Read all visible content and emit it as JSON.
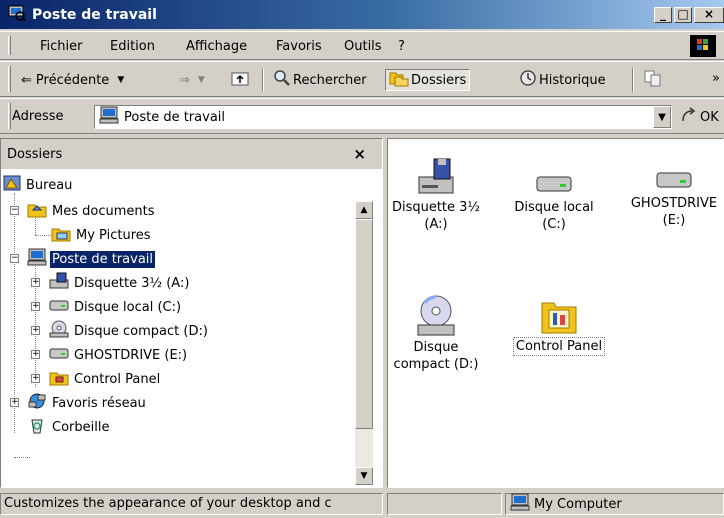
{
  "window": {
    "title": "Poste de travail",
    "buttons": {
      "minimize": "_",
      "maximize": "□",
      "close": "×"
    }
  },
  "menu": [
    "Fichier",
    "Edition",
    "Affichage",
    "Favoris",
    "Outils",
    "?"
  ],
  "toolbar": {
    "back": "Précédente",
    "search": "Rechercher",
    "folders": "Dossiers",
    "history": "Historique",
    "more": "»"
  },
  "address": {
    "label": "Adresse",
    "value": "Poste de travail",
    "go": "OK"
  },
  "folders_pane": {
    "title": "Dossiers",
    "close": "×",
    "tree": [
      {
        "label": "Bureau",
        "icon": "desktop-icon"
      },
      {
        "label": "Mes documents",
        "icon": "my-documents-icon"
      },
      {
        "label": "My Pictures",
        "icon": "my-pictures-icon"
      },
      {
        "label": "Poste de travail",
        "icon": "my-computer-icon",
        "selected": true
      },
      {
        "label": "Disquette 3½ (A:)",
        "icon": "floppy-drive-icon"
      },
      {
        "label": "Disque local (C:)",
        "icon": "hard-drive-icon"
      },
      {
        "label": "Disque compact (D:)",
        "icon": "cd-drive-icon"
      },
      {
        "label": "GHOSTDRIVE (E:)",
        "icon": "hard-drive-icon"
      },
      {
        "label": "Control Panel",
        "icon": "control-panel-icon"
      },
      {
        "label": "Favoris réseau",
        "icon": "network-places-icon"
      },
      {
        "label": "Corbeille",
        "icon": "recycle-bin-icon"
      }
    ]
  },
  "files": [
    {
      "line1": "Disquette 3½",
      "line2": "(A:)",
      "icon": "floppy-drive-icon"
    },
    {
      "line1": "Disque local",
      "line2": "(C:)",
      "icon": "hard-drive-icon"
    },
    {
      "line1": "GHOSTDRIVE",
      "line2": "(E:)",
      "icon": "hard-drive-icon"
    },
    {
      "line1": "Disque",
      "line2": "compact (D:)",
      "icon": "cd-drive-icon"
    },
    {
      "line1": "Control Panel",
      "line2": "",
      "icon": "control-panel-icon"
    }
  ],
  "status": {
    "text": "Customizes the appearance of your desktop and c",
    "zone": "My Computer"
  },
  "colors": {
    "title_start": "#0a246a",
    "title_end": "#a6caf0",
    "selection": "#0a246a",
    "face": "#d4d0c8"
  }
}
